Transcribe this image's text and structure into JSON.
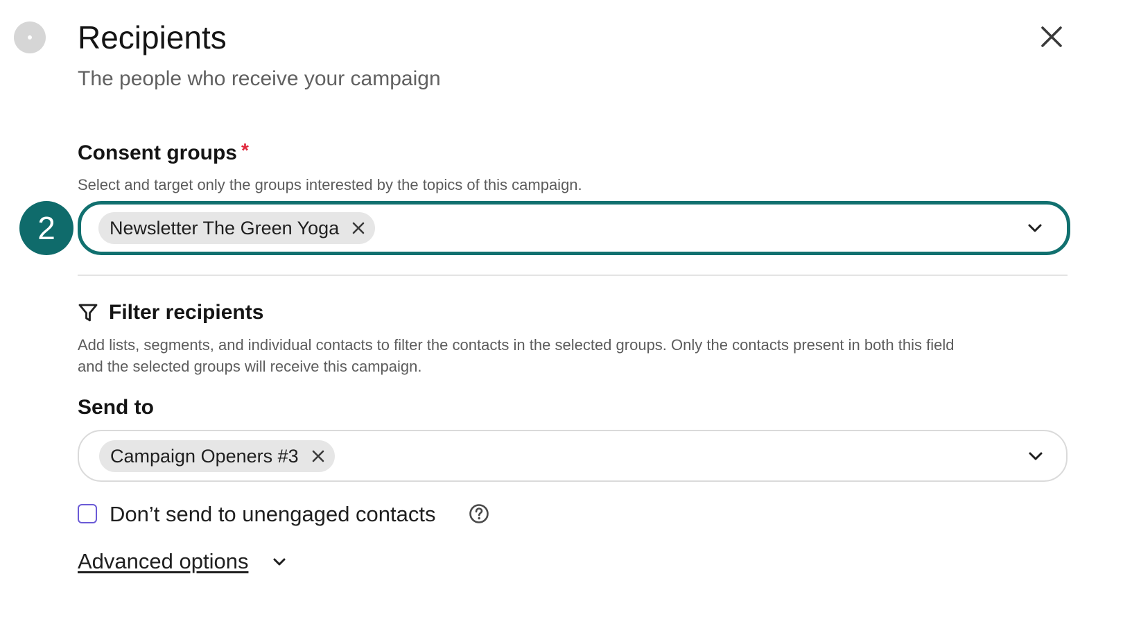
{
  "header": {
    "title": "Recipients",
    "subtitle": "The people who receive your campaign"
  },
  "consent_groups": {
    "label": "Consent groups",
    "required_mark": "*",
    "help": "Select and target only the groups interested by the topics of this campaign.",
    "step_badge": "2",
    "selected": [
      "Newsletter The Green Yoga"
    ]
  },
  "filter": {
    "title": "Filter recipients",
    "help": "Add lists, segments, and individual contacts to filter the contacts in the selected groups. Only the contacts present in both this field and the selected groups will receive this campaign.",
    "help_line1": "Add lists, segments, and individual contacts to filter the contacts in the selected groups. Only the contacts present in both this field",
    "help_line2": "and the selected groups will receive this campaign."
  },
  "send_to": {
    "label": "Send to",
    "selected": [
      "Campaign Openers #3"
    ]
  },
  "options": {
    "unengaged_label": "Don’t send to unengaged contacts",
    "unengaged_checked": false,
    "advanced_label": "Advanced options"
  },
  "colors": {
    "accent_teal": "#11706f",
    "required_red": "#e0283d",
    "checkbox_border": "#6a5ad6"
  },
  "icons": [
    "close-icon",
    "chevron-down-icon",
    "filter-icon",
    "question-circle-icon"
  ]
}
